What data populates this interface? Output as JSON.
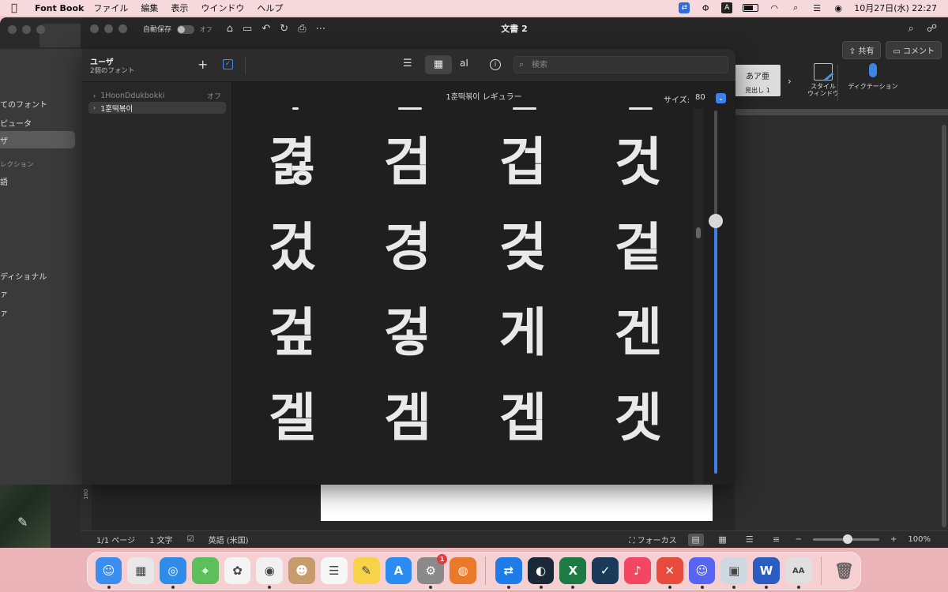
{
  "menubar": {
    "app_name": "Font Book",
    "menus": [
      "ファイル",
      "編集",
      "表示",
      "ウインドウ",
      "ヘルプ"
    ],
    "datetime": "10月27日(水)  22:27",
    "input_indicator": "A"
  },
  "word": {
    "autosave_label": "自動保存",
    "autosave_state": "オフ",
    "doc_title": "文書 2",
    "share_label": "共有",
    "comment_label": "コメント",
    "styles_sample": "あア亜",
    "styles_name": "見出し 1",
    "style_window_label": "スタイル\nウィンドウ",
    "dictation_label": "ディクテーション",
    "ruler_mark": "160",
    "status": {
      "page": "1/1 ページ",
      "words": "1 文字",
      "language": "英語 (米国)",
      "focus": "フォーカス",
      "zoom": "100%"
    }
  },
  "sidebar": {
    "items": [
      {
        "label": "てのフォント",
        "selected": false
      },
      {
        "label": "ピュータ",
        "selected": false
      },
      {
        "label": "ザ",
        "selected": true
      }
    ],
    "section_label": "レクション",
    "section_items": [
      "語",
      "ディショナル",
      "ァ",
      "ァ"
    ]
  },
  "fontbook": {
    "title": "ユーザ",
    "subtitle": "2個のフォント",
    "search_placeholder": "検索",
    "fonts": [
      {
        "name": "1HoonDdukbokki",
        "status": "オフ",
        "selected": false
      },
      {
        "name": "1훈떡볶이",
        "status": "",
        "selected": true
      }
    ],
    "preview_header": "1훈떡볶이 レギュラー",
    "size_label": "サイズ:",
    "size_value": "80",
    "size_slider_fraction": 0.3,
    "glyphs": [
      "겷",
      "검",
      "겁",
      "것",
      "겄",
      "경",
      "겆",
      "겉",
      "겊",
      "겋",
      "게",
      "겐",
      "겔",
      "겜",
      "겝",
      "겟"
    ]
  },
  "dock": {
    "apps": [
      {
        "name": "finder",
        "color": "#3b8ef0",
        "glyph": "☺",
        "running": true
      },
      {
        "name": "launchpad",
        "color": "#e8e8e8",
        "glyph": "▦",
        "running": false
      },
      {
        "name": "safari",
        "color": "#2f8de9",
        "glyph": "◎",
        "running": true
      },
      {
        "name": "maps",
        "color": "#5cbf5c",
        "glyph": "⌖",
        "running": false
      },
      {
        "name": "photos",
        "color": "#f4f4f4",
        "glyph": "✿",
        "running": false
      },
      {
        "name": "chrome",
        "color": "#f1f1f1",
        "glyph": "◉",
        "running": true
      },
      {
        "name": "contacts",
        "color": "#c69c6d",
        "glyph": "☻",
        "running": false
      },
      {
        "name": "reminders",
        "color": "#f7f7f7",
        "glyph": "☰",
        "running": false
      },
      {
        "name": "notes",
        "color": "#f8d34a",
        "glyph": "✎",
        "running": false
      },
      {
        "name": "app-store",
        "color": "#2a8cf0",
        "glyph": "A",
        "running": false
      },
      {
        "name": "system-preferences",
        "color": "#8a8a8a",
        "glyph": "⚙",
        "running": true,
        "badge": "1"
      },
      {
        "name": "blender",
        "color": "#ea7a29",
        "glyph": "◍",
        "running": false
      },
      {
        "name": "teamviewer",
        "color": "#1d7ce8",
        "glyph": "⇄",
        "running": true
      },
      {
        "name": "steam",
        "color": "#1b2838",
        "glyph": "◐",
        "running": true
      },
      {
        "name": "excel",
        "color": "#1e7a45",
        "glyph": "X",
        "running": true
      },
      {
        "name": "feather-app",
        "color": "#1b3a5a",
        "glyph": "✓",
        "running": false
      },
      {
        "name": "music",
        "color": "#f24663",
        "glyph": "♪",
        "running": false
      },
      {
        "name": "x-app",
        "color": "#e84a3b",
        "glyph": "✕",
        "running": true
      },
      {
        "name": "discord",
        "color": "#5865f2",
        "glyph": "☺",
        "running": true
      },
      {
        "name": "preview",
        "color": "#cfd8e0",
        "glyph": "▣",
        "running": true
      },
      {
        "name": "word",
        "color": "#2b5cc0",
        "glyph": "W",
        "running": true
      },
      {
        "name": "font-book",
        "color": "#dfdfdf",
        "glyph": "AA",
        "running": true
      }
    ],
    "trash_glyph": "🗑"
  }
}
